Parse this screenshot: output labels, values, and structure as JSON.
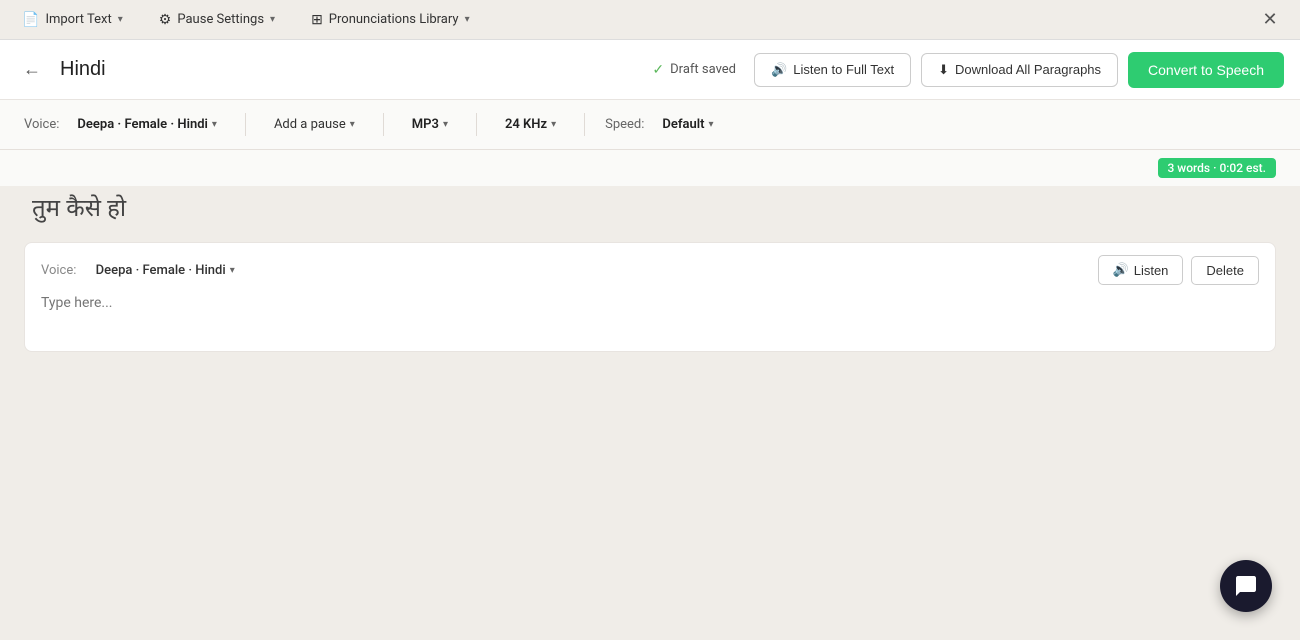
{
  "menubar": {
    "import_text": "Import Text",
    "pause_settings": "Pause Settings",
    "pronunciations_library": "Pronunciations Library",
    "close_icon": "✕"
  },
  "header": {
    "title": "Hindi",
    "draft_saved": "Draft saved",
    "listen_full_text": "Listen to Full Text",
    "download_all": "Download All Paragraphs",
    "convert_to_speech": "Convert to Speech"
  },
  "toolbar": {
    "voice_label": "Voice:",
    "voice_value": "Deepa · Female · Hindi",
    "add_pause_label": "Add a pause",
    "format_label": "MP3",
    "quality_label": "24 KHz",
    "speed_label": "Speed:",
    "speed_value": "Default"
  },
  "word_count": {
    "badge": "3 words · 0:02 est."
  },
  "main_text": "तुम कैसे हो",
  "paragraph": {
    "voice_label": "Voice:",
    "voice_value": "Deepa · Female · Hindi",
    "listen_btn": "Listen",
    "delete_btn": "Delete",
    "placeholder": "Type here..."
  },
  "icons": {
    "back": "←",
    "check": "✓",
    "volume": "🔊",
    "download": "⬇",
    "gear": "⚙",
    "grid": "⊞",
    "file": "📄",
    "chat": "💬"
  }
}
